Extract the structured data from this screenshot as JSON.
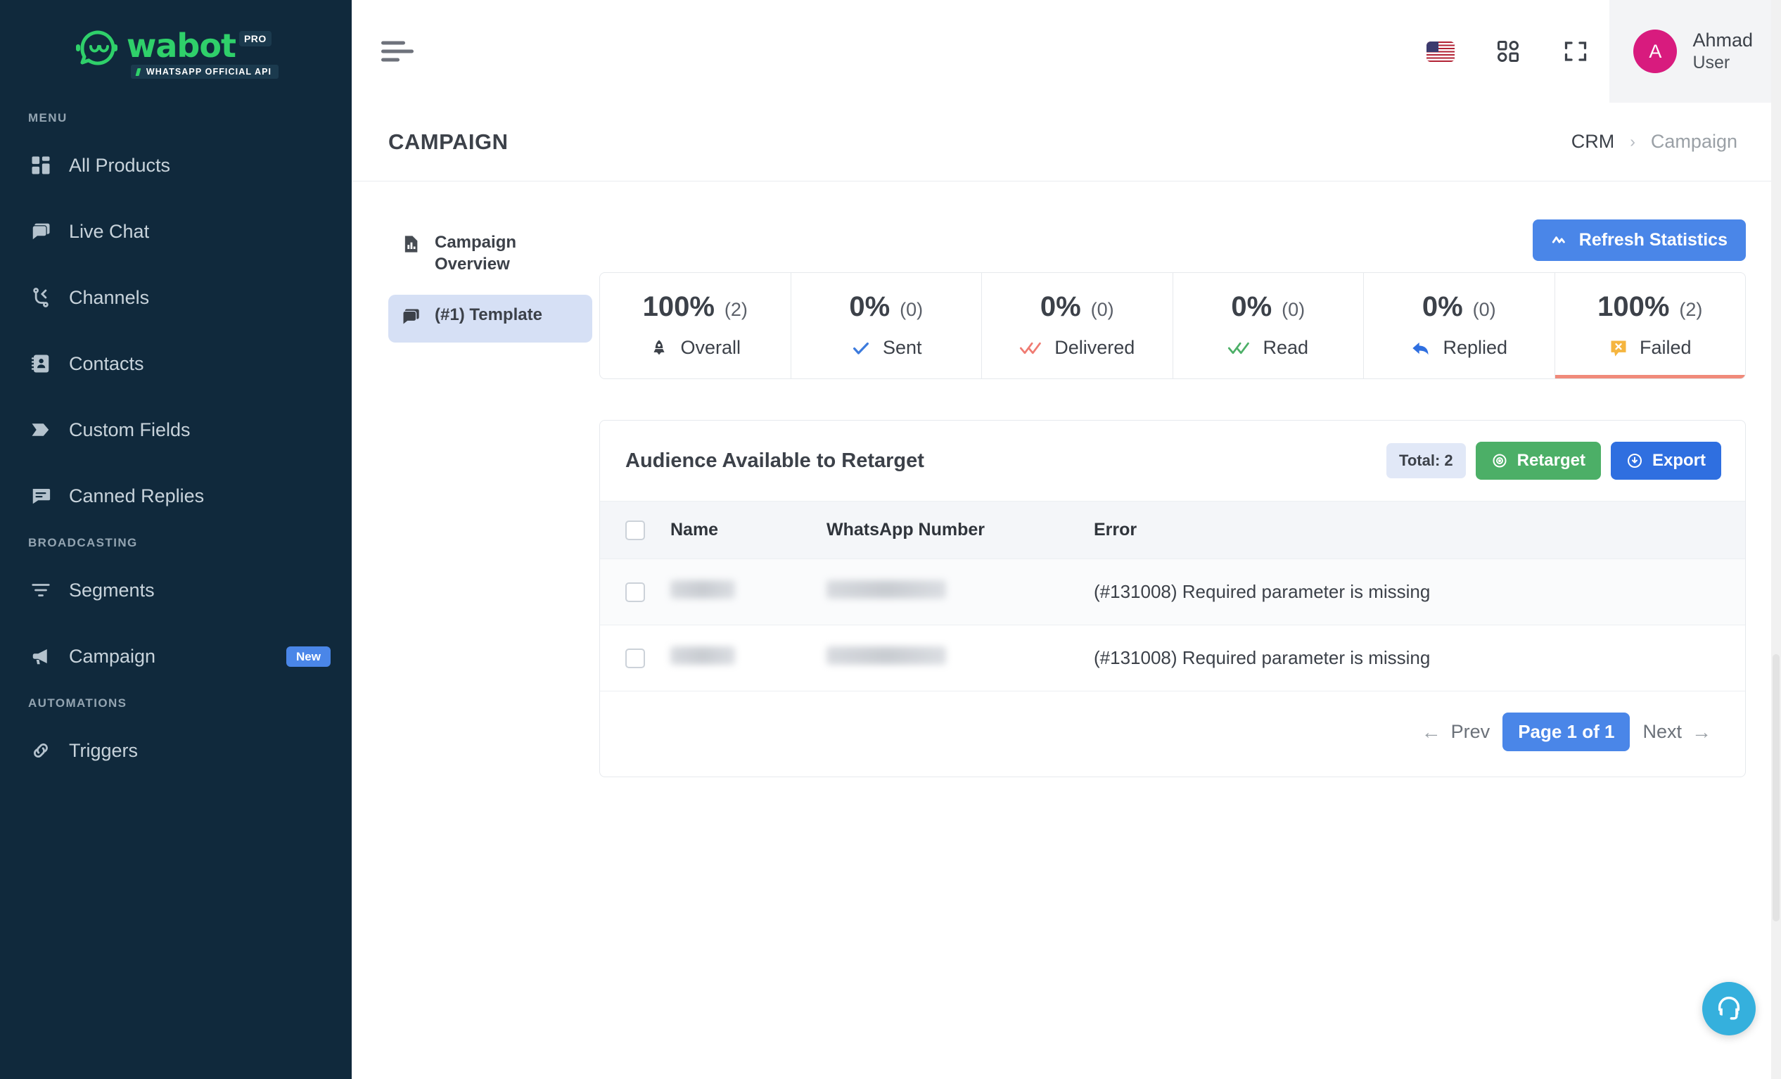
{
  "brand": {
    "logo_word": "wabot",
    "logo_pro": "PRO",
    "logo_tagline": "WHATSAPP OFFICIAL API",
    "accent_green": "#2fd06a",
    "sidebar_bg": "#10293c"
  },
  "sidebar": {
    "sections": [
      {
        "label": "MENU",
        "items": [
          {
            "label": "All Products",
            "icon": "grid-icon"
          },
          {
            "label": "Live Chat",
            "icon": "chat-bubbles-icon"
          },
          {
            "label": "Channels",
            "icon": "channels-icon"
          },
          {
            "label": "Contacts",
            "icon": "contact-book-icon"
          },
          {
            "label": "Custom Fields",
            "icon": "tag-icon"
          },
          {
            "label": "Canned Replies",
            "icon": "canned-reply-icon"
          }
        ]
      },
      {
        "label": "BROADCASTING",
        "items": [
          {
            "label": "Segments",
            "icon": "filter-icon"
          },
          {
            "label": "Campaign",
            "icon": "megaphone-icon",
            "badge": "New"
          }
        ]
      },
      {
        "label": "AUTOMATIONS",
        "items": [
          {
            "label": "Triggers",
            "icon": "link-icon"
          }
        ]
      }
    ]
  },
  "topbar": {
    "menu_toggle": "hamburger-icon",
    "language_flag": "us-flag-icon",
    "apps_icon": "apps-grid-icon",
    "fullscreen_icon": "fullscreen-icon",
    "user": {
      "initial": "A",
      "name": "Ahmad",
      "role": "User",
      "avatar_color": "#d81b7e"
    }
  },
  "pagehead": {
    "title": "CAMPAIGN",
    "breadcrumb": {
      "root": "CRM",
      "separator": "›",
      "current": "Campaign"
    }
  },
  "side_tabs": [
    {
      "label": "Campaign Overview",
      "icon": "report-chart-icon",
      "active": false
    },
    {
      "label": "(#1) Template",
      "icon": "chat-bubbles-icon",
      "active": true
    }
  ],
  "toolbar": {
    "refresh_label": "Refresh Statistics",
    "refresh_icon": "pulse-icon",
    "refresh_color": "#4a86e8"
  },
  "stats": [
    {
      "percent": "100%",
      "count": "(2)",
      "label": "Overall",
      "icon": "rocket-icon",
      "color": "#3c4149",
      "selected": false
    },
    {
      "percent": "0%",
      "count": "(0)",
      "label": "Sent",
      "icon": "check-icon",
      "color": "#3d7bdd",
      "selected": false
    },
    {
      "percent": "0%",
      "count": "(0)",
      "label": "Delivered",
      "icon": "double-check-icon",
      "color": "#ef7b72",
      "selected": false
    },
    {
      "percent": "0%",
      "count": "(0)",
      "label": "Read",
      "icon": "double-check-icon",
      "color": "#4caf67",
      "selected": false
    },
    {
      "percent": "0%",
      "count": "(0)",
      "label": "Replied",
      "icon": "reply-arrow-icon",
      "color": "#2f6fe0",
      "selected": false
    },
    {
      "percent": "100%",
      "count": "(2)",
      "label": "Failed",
      "icon": "failed-bubble-icon",
      "color": "#f5b53f",
      "selected": true
    }
  ],
  "audience": {
    "title": "Audience Available to Retarget",
    "total_label": "Total: 2",
    "retarget_label": "Retarget",
    "retarget_icon": "target-icon",
    "export_label": "Export",
    "export_icon": "download-cloud-icon",
    "columns": [
      "Name",
      "WhatsApp Number",
      "Error"
    ],
    "rows": [
      {
        "name": "",
        "number": "",
        "error": "(#131008) Required parameter is missing",
        "redacted": true
      },
      {
        "name": "",
        "number": "",
        "error": "(#131008) Required parameter is missing",
        "redacted": true
      }
    ]
  },
  "pagination": {
    "prev_label": "Prev",
    "current_label": "Page 1 of 1",
    "next_label": "Next",
    "prev_arrow": "←",
    "next_arrow": "→"
  },
  "support": {
    "icon": "headset-icon",
    "color": "#35b0dd"
  }
}
